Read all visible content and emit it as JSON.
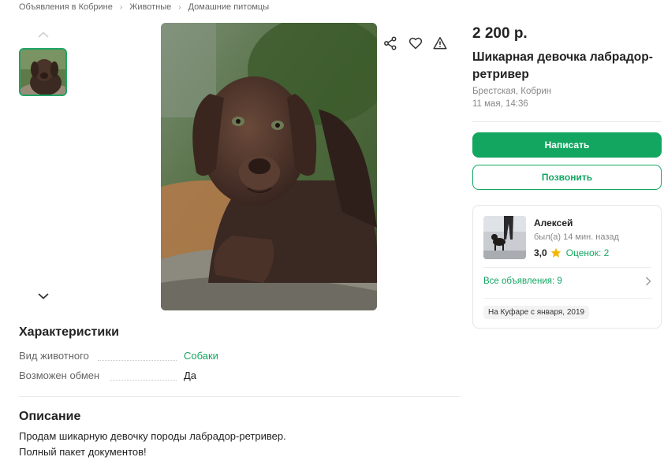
{
  "breadcrumb": [
    {
      "label": "Объявления в Кобрине"
    },
    {
      "label": "Животные"
    },
    {
      "label": "Домашние питомцы"
    }
  ],
  "listing": {
    "price": "2 200 р.",
    "title": "Шикарная девочка лабрадор-ретривер",
    "location": "Брестская, Кобрин",
    "date": "11 мая, 14:36"
  },
  "actions": {
    "write": "Написать",
    "call": "Позвонить"
  },
  "seller": {
    "name": "Алексей",
    "status": "был(а) 14 мин. назад",
    "rating": "3,0",
    "reviews": "Оценок: 2",
    "all_ads": "Все объявления: 9",
    "since": "На Куфаре с января, 2019"
  },
  "characteristics": {
    "title": "Характеристики",
    "items": [
      {
        "key": "Вид животного",
        "value": "Собаки"
      },
      {
        "key": "Возможен обмен",
        "value": "Да"
      }
    ]
  },
  "description": {
    "title": "Описание",
    "lines": [
      "Продам шикарную девочку породы лабрадор-ретривер.",
      "Полный пакет документов!"
    ]
  },
  "colors": {
    "accent": "#13a661",
    "star": "#f5b800"
  },
  "icons": [
    "chevron-up-icon",
    "chevron-down-icon",
    "share-icon",
    "heart-icon",
    "warning-icon",
    "star-icon",
    "chevron-right-icon"
  ]
}
